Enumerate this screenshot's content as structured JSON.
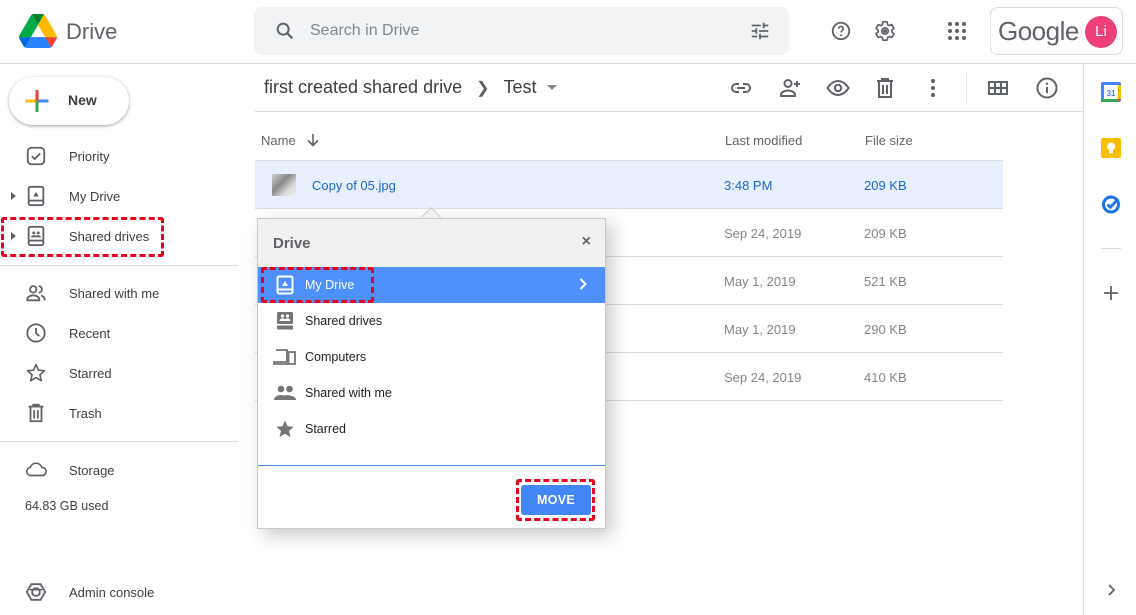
{
  "header": {
    "app_name": "Drive",
    "search_placeholder": "Search in Drive",
    "google_label": "Google",
    "avatar_initials": "Li",
    "avatar_color": "#ec407a"
  },
  "sidebar": {
    "new_label": "New",
    "items": [
      {
        "label": "Priority",
        "icon": "priority-icon"
      },
      {
        "label": "My Drive",
        "icon": "my-drive-icon",
        "expandable": true
      },
      {
        "label": "Shared drives",
        "icon": "shared-drives-icon",
        "expandable": true,
        "highlighted": true
      },
      {
        "label": "Shared with me",
        "icon": "shared-with-me-icon"
      },
      {
        "label": "Recent",
        "icon": "clock-icon"
      },
      {
        "label": "Starred",
        "icon": "star-icon"
      },
      {
        "label": "Trash",
        "icon": "trash-icon"
      }
    ],
    "storage": {
      "label": "Storage",
      "used": "64.83 GB used"
    },
    "admin_console": "Admin console"
  },
  "main": {
    "breadcrumb": {
      "parent": "first created shared drive",
      "current": "Test"
    },
    "toolbar": [
      "link-icon",
      "add-person-icon",
      "preview-icon",
      "trash-icon",
      "more-vert-icon",
      "grid-view-icon",
      "info-icon"
    ],
    "columns": {
      "name": "Name",
      "modified": "Last modified",
      "size": "File size"
    },
    "files": [
      {
        "name": "Copy of 05.jpg",
        "modified": "3:48 PM",
        "size": "209 KB",
        "selected": true
      },
      {
        "name": "",
        "modified": "Sep 24, 2019",
        "size": "209 KB"
      },
      {
        "name": "",
        "modified": "May 1, 2019",
        "size": "521 KB"
      },
      {
        "name": "",
        "modified": "May 1, 2019",
        "size": "290 KB"
      },
      {
        "name": "",
        "modified": "Sep 24, 2019",
        "size": "410 KB"
      }
    ]
  },
  "move_dialog": {
    "title": "Drive",
    "close": "×",
    "items": [
      {
        "label": "My Drive",
        "active": true
      },
      {
        "label": "Shared drives"
      },
      {
        "label": "Computers"
      },
      {
        "label": "Shared with me"
      },
      {
        "label": "Starred"
      }
    ],
    "move_label": "MOVE",
    "accent": "#4d90fe"
  },
  "right_rail": [
    "calendar-icon",
    "keep-icon",
    "tasks-icon",
    "add-icon",
    "expand-icon"
  ]
}
